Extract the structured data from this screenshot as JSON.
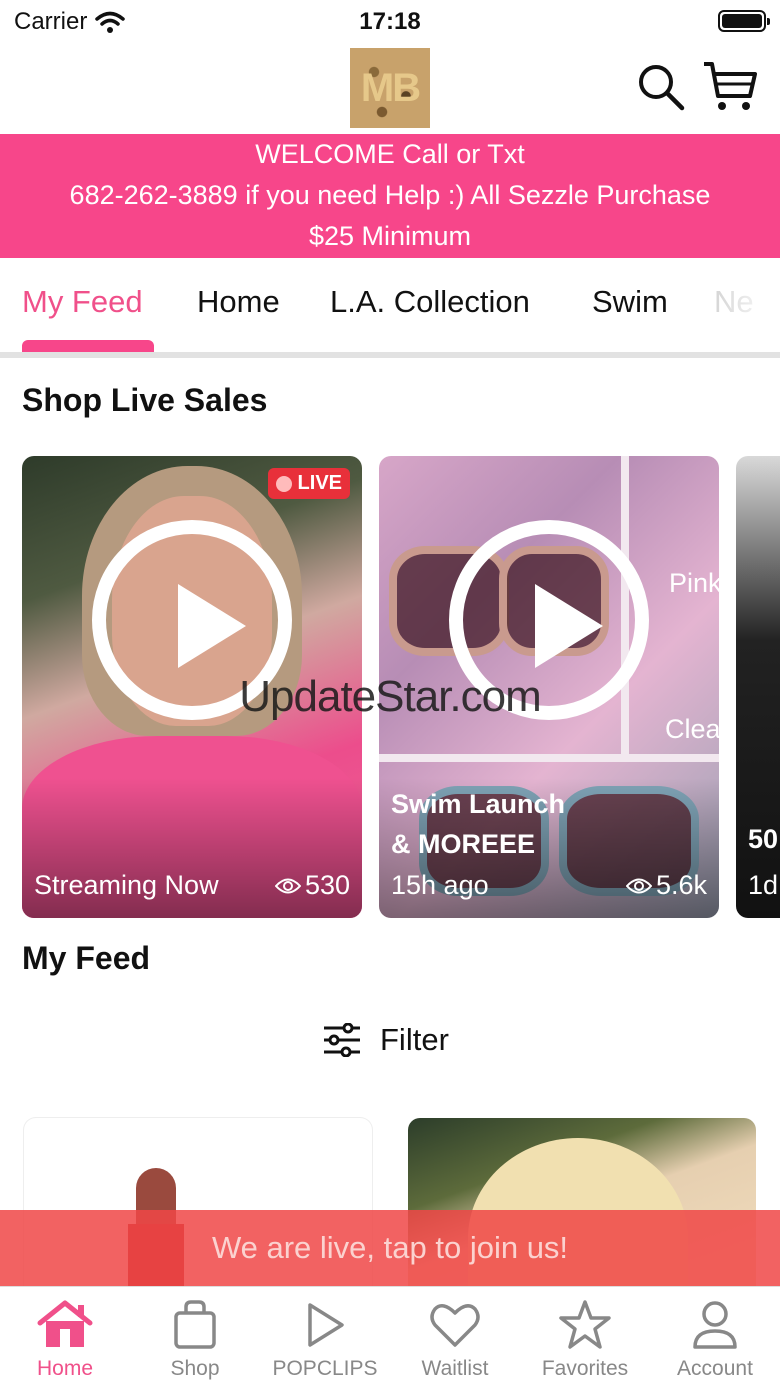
{
  "status_bar": {
    "carrier": "Carrier",
    "time": "17:18"
  },
  "header": {
    "logo_text": "MB"
  },
  "banner": {
    "line1": "WELCOME  Call or Txt",
    "line2": "682-262-3889 if  you need Help :) All Sezzle Purchase",
    "line3": "$25 Minimum"
  },
  "tabs": [
    "My Feed",
    "Home",
    "L.A. Collection",
    "Swim",
    "Ne"
  ],
  "live_sales": {
    "title": "Shop Live Sales",
    "cards": [
      {
        "badge": "LIVE",
        "title": "",
        "meta": "Streaming Now",
        "views": "530"
      },
      {
        "badge": "",
        "title_line1": "Swim Launch",
        "title_line2": "& MOREEE",
        "meta": "15h ago",
        "views": "5.6k",
        "overlay1": "Pink",
        "overlay2": "Clea"
      },
      {
        "title": "50",
        "meta": "1d"
      }
    ]
  },
  "watermark": "UpdateStar.com",
  "feed": {
    "title": "My Feed",
    "filter_label": "Filter"
  },
  "toast": "We are live, tap to join us!",
  "tab_bar": {
    "items": [
      "Home",
      "Shop",
      "POPCLIPS",
      "Waitlist",
      "Favorites",
      "Account"
    ],
    "active": "Home"
  },
  "colors": {
    "accent": "#f7468a",
    "live_red": "#e8303a",
    "inactive": "#888888"
  }
}
